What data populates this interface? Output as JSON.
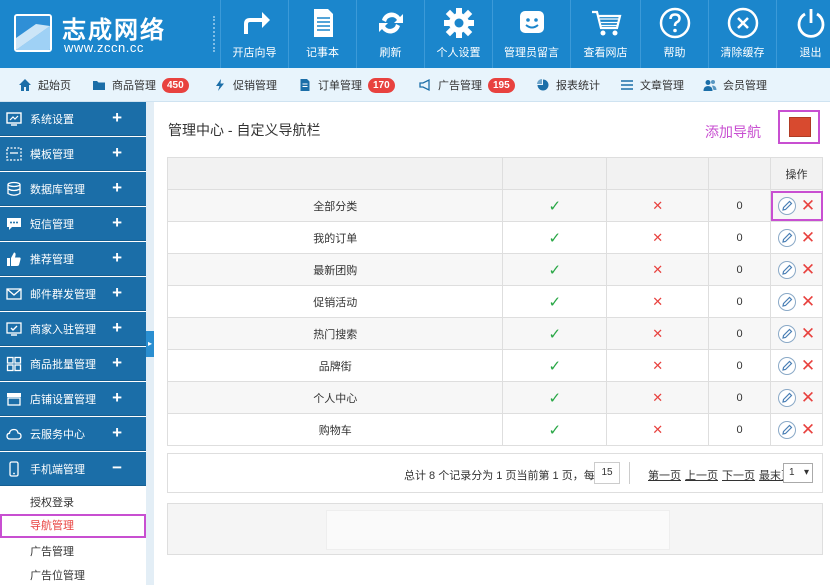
{
  "logo": {
    "title": "志成网络",
    "subtitle": "www.zccn.cc"
  },
  "topnav": [
    {
      "label": "开店向导",
      "icon": "arrow-forward-icon"
    },
    {
      "label": "记事本",
      "icon": "notepad-icon"
    },
    {
      "label": "刷新",
      "icon": "refresh-icon"
    },
    {
      "label": "个人设置",
      "icon": "gear-icon"
    },
    {
      "label": "管理员留言",
      "icon": "smiley-message-icon"
    },
    {
      "label": "查看网店",
      "icon": "cart-icon"
    },
    {
      "label": "帮助",
      "icon": "help-icon"
    },
    {
      "label": "清除缓存",
      "icon": "clear-icon"
    },
    {
      "label": "退出",
      "icon": "power-icon"
    }
  ],
  "subnav": [
    {
      "label": "起始页",
      "icon": "home-icon"
    },
    {
      "label": "商品管理",
      "icon": "folder-icon",
      "badge": "450"
    },
    {
      "label": "促销管理",
      "icon": "lightning-icon"
    },
    {
      "label": "订单管理",
      "icon": "document-icon",
      "badge": "170"
    },
    {
      "label": "广告管理",
      "icon": "megaphone-icon",
      "badge": "195"
    },
    {
      "label": "报表统计",
      "icon": "pie-chart-icon"
    },
    {
      "label": "文章管理",
      "icon": "list-icon"
    },
    {
      "label": "会员管理",
      "icon": "users-icon"
    }
  ],
  "sidebar": {
    "items": [
      {
        "label": "系统设置",
        "toggle": "+"
      },
      {
        "label": "模板管理",
        "toggle": "+"
      },
      {
        "label": "数据库管理",
        "toggle": "+"
      },
      {
        "label": "短信管理",
        "toggle": "+"
      },
      {
        "label": "推荐管理",
        "toggle": "+"
      },
      {
        "label": "邮件群发管理",
        "toggle": "+"
      },
      {
        "label": "商家入驻管理",
        "toggle": "+"
      },
      {
        "label": "商品批量管理",
        "toggle": "+"
      },
      {
        "label": "店铺设置管理",
        "toggle": "+"
      },
      {
        "label": "云服务中心",
        "toggle": "+"
      },
      {
        "label": "手机端管理",
        "toggle": "−"
      }
    ],
    "subitems": [
      {
        "label": "授权登录"
      },
      {
        "label": "导航管理",
        "active": true
      },
      {
        "label": "广告管理"
      },
      {
        "label": "广告位管理"
      }
    ],
    "toggle_glyph": "▸"
  },
  "main": {
    "title": "管理中心 - 自定义导航栏",
    "add_label": "添加导航",
    "table": {
      "op_header": "操作",
      "rows": [
        {
          "name": "全部分类",
          "show": "✓",
          "new_window": "✕",
          "order": "0"
        },
        {
          "name": "我的订单",
          "show": "✓",
          "new_window": "✕",
          "order": "0"
        },
        {
          "name": "最新团购",
          "show": "✓",
          "new_window": "✕",
          "order": "0"
        },
        {
          "name": "促销活动",
          "show": "✓",
          "new_window": "✕",
          "order": "0"
        },
        {
          "name": "热门搜索",
          "show": "✓",
          "new_window": "✕",
          "order": "0"
        },
        {
          "name": "品牌街",
          "show": "✓",
          "new_window": "✕",
          "order": "0"
        },
        {
          "name": "个人中心",
          "show": "✓",
          "new_window": "✕",
          "order": "0"
        },
        {
          "name": "购物车",
          "show": "✓",
          "new_window": "✕",
          "order": "0"
        }
      ]
    },
    "pager": {
      "info": "总计 8 个记录分为 1 页当前第 1 页，每页",
      "page_size": "15",
      "first": "第一页",
      "prev": "上一页",
      "next": "下一页",
      "last": "最末页",
      "page_select": "1"
    }
  },
  "colors": {
    "header_blue": "#1b86cc",
    "sidebar_blue": "#1b6ea8",
    "badge_red": "#e8423f",
    "highlight_purple": "#c84fd1",
    "check_green": "#28a745",
    "add_button": "#d84a2f"
  }
}
